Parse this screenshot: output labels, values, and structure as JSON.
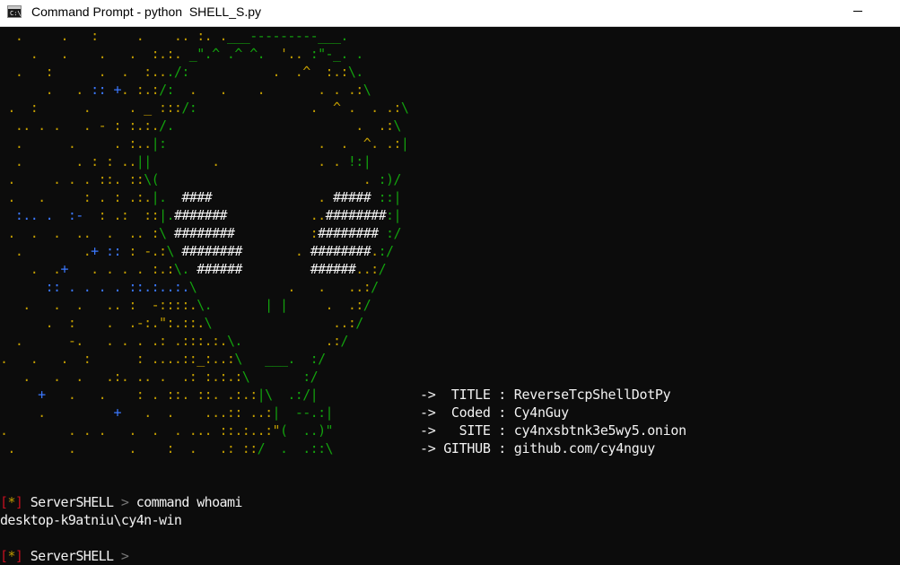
{
  "window": {
    "title": "Command Prompt - python  SHELL_S.py",
    "icon_text": "C:\\.",
    "icon": "cmd-icon"
  },
  "colors": {
    "background": "#0c0c0c",
    "ascii_yellow": "#c19c00",
    "ascii_blue": "#3b78ff",
    "ascii_green": "#13a10e",
    "text_white": "#f2f2f2",
    "prompt_red": "#c50f1f"
  },
  "ascii_art": [
    [
      [
        "y",
        "  .     .   :     .    .. :. ."
      ],
      [
        "g",
        "___---------___."
      ]
    ],
    [
      [
        "y",
        "    .   .    .   .  :.:. "
      ],
      [
        "g",
        "_\".^ .^ ^.  "
      ],
      [
        "y",
        "'.. "
      ],
      [
        "g",
        ":\"-_. ."
      ]
    ],
    [
      [
        "y",
        "  .   :      .  .  :.."
      ],
      [
        "g",
        "./:"
      ],
      [
        "y",
        "           .  .^  :.:"
      ],
      [
        "g",
        "\\."
      ]
    ],
    [
      [
        "y",
        "      .   . "
      ],
      [
        "b",
        ":: +"
      ],
      [
        "y",
        ". :.:"
      ],
      [
        "g",
        "/:"
      ],
      [
        "y",
        "  .   .    .       . . .:"
      ],
      [
        "g",
        "\\"
      ]
    ],
    [
      [
        "y",
        " .  :      .     . _ :::"
      ],
      [
        "g",
        "/:"
      ],
      [
        "y",
        "               .  ^ .  . .:"
      ],
      [
        "g",
        "\\"
      ]
    ],
    [
      [
        "y",
        "  .. . .   . - : :.:."
      ],
      [
        "g",
        "/."
      ],
      [
        "y",
        "                        .  .:"
      ],
      [
        "g",
        "\\"
      ]
    ],
    [
      [
        "y",
        "  .      .     . :.."
      ],
      [
        "g",
        "|:"
      ],
      [
        "y",
        "                    .  .  ^. .:"
      ],
      [
        "g",
        "|"
      ]
    ],
    [
      [
        "y",
        "  .       . : : .."
      ],
      [
        "g",
        "||"
      ],
      [
        "y",
        "        .             . . "
      ],
      [
        "g",
        "!:|"
      ]
    ],
    [
      [
        "y",
        " .     . . . ::. ::"
      ],
      [
        "g",
        "\\("
      ],
      [
        "y",
        "                           . "
      ],
      [
        "g",
        ":)/"
      ]
    ],
    [
      [
        "y",
        " .   .     : . : .:."
      ],
      [
        "g",
        "|.  "
      ],
      [
        "w",
        "####"
      ],
      [
        "y",
        "              . "
      ],
      [
        "w",
        "#####"
      ],
      [
        "g",
        " ::|"
      ]
    ],
    [
      [
        "b",
        "  :.. .  :- "
      ],
      [
        "y",
        " : .:  ::"
      ],
      [
        "g",
        "|."
      ],
      [
        "w",
        "#######"
      ],
      [
        "y",
        "           .."
      ],
      [
        "w",
        "########"
      ],
      [
        "g",
        ":|"
      ]
    ],
    [
      [
        "y",
        " .  .  .  ..  .  .. :"
      ],
      [
        "g",
        "\\ "
      ],
      [
        "w",
        "########"
      ],
      [
        "y",
        "          :"
      ],
      [
        "w",
        "######## "
      ],
      [
        "g",
        ":/"
      ]
    ],
    [
      [
        "y",
        "  .        ."
      ],
      [
        "b",
        "+ ::"
      ],
      [
        "y",
        " : -.:"
      ],
      [
        "g",
        "\\ "
      ],
      [
        "w",
        "########"
      ],
      [
        "y",
        "       . "
      ],
      [
        "w",
        "########"
      ],
      [
        "y",
        "."
      ],
      [
        "g",
        ":/"
      ]
    ],
    [
      [
        "y",
        "    .  ."
      ],
      [
        "b",
        "+"
      ],
      [
        "y",
        "   . . . . :.:"
      ],
      [
        "g",
        "\\. "
      ],
      [
        "w",
        "######"
      ],
      [
        "y",
        "         "
      ],
      [
        "w",
        "######"
      ],
      [
        "y",
        "..:"
      ],
      [
        "g",
        "/"
      ]
    ],
    [
      [
        "b",
        "      :: . . . . ::.:..:."
      ],
      [
        "g",
        "\\"
      ],
      [
        "y",
        "            .   .   ..:"
      ],
      [
        "g",
        "/"
      ]
    ],
    [
      [
        "y",
        "   .   .  .   .. :  -::::."
      ],
      [
        "g",
        "\\.       | |"
      ],
      [
        "y",
        "     .  .:"
      ],
      [
        "g",
        "/"
      ]
    ],
    [
      [
        "y",
        "      .  :    .  .-:.\":.::."
      ],
      [
        "g",
        "\\"
      ],
      [
        "y",
        "                ..:"
      ],
      [
        "g",
        "/"
      ]
    ],
    [
      [
        "y",
        "  .      -.   . . . .: .:::.:."
      ],
      [
        "g",
        "\\."
      ],
      [
        "y",
        "           .:"
      ],
      [
        "g",
        "/"
      ]
    ],
    [
      [
        "y",
        ".   .   .  :      : ....::_:..:"
      ],
      [
        "g",
        "\\   ___.  :/"
      ]
    ],
    [
      [
        "y",
        "   .   .  .   .:. .. .  .: :.:.:"
      ],
      [
        "g",
        "\\       :/"
      ]
    ],
    [
      [
        "b",
        "     +"
      ],
      [
        "y",
        "   .   .    : . ::. ::. .:.:"
      ],
      [
        "g",
        "|\\  .:/|"
      ]
    ],
    [
      [
        "y",
        "     .         "
      ],
      [
        "b",
        "+"
      ],
      [
        "y",
        "   .  .    ...:: ..:"
      ],
      [
        "g",
        "|  --.:|"
      ]
    ],
    [
      [
        "y",
        ".        . . .   .  .  . ... ::.:..:\""
      ],
      [
        "g",
        "(  ..)\""
      ]
    ],
    [
      [
        "y",
        " .       .       .    :  .   .: ::"
      ],
      [
        "g",
        "/  .  .::\\"
      ]
    ]
  ],
  "info_lines": [
    [
      "->  TITLE : ",
      "ReverseTcpShellDotPy"
    ],
    [
      "->  Coded : ",
      "Cy4nGuy"
    ],
    [
      "->   SITE : ",
      "cy4nxsbtnk3e5wy5.onion"
    ],
    [
      "-> GITHUB : ",
      "github.com/cy4nguy"
    ]
  ],
  "console": {
    "prompt1": {
      "bracket_open": "[",
      "star": "*",
      "bracket_close": "]",
      "name": " ServerSHELL ",
      "arrow": ">",
      "command": " command whoami"
    },
    "output": "desktop-k9atniu\\cy4n-win",
    "prompt2": {
      "bracket_open": "[",
      "star": "*",
      "bracket_close": "]",
      "name": " ServerSHELL ",
      "arrow": ">",
      "command": ""
    }
  }
}
